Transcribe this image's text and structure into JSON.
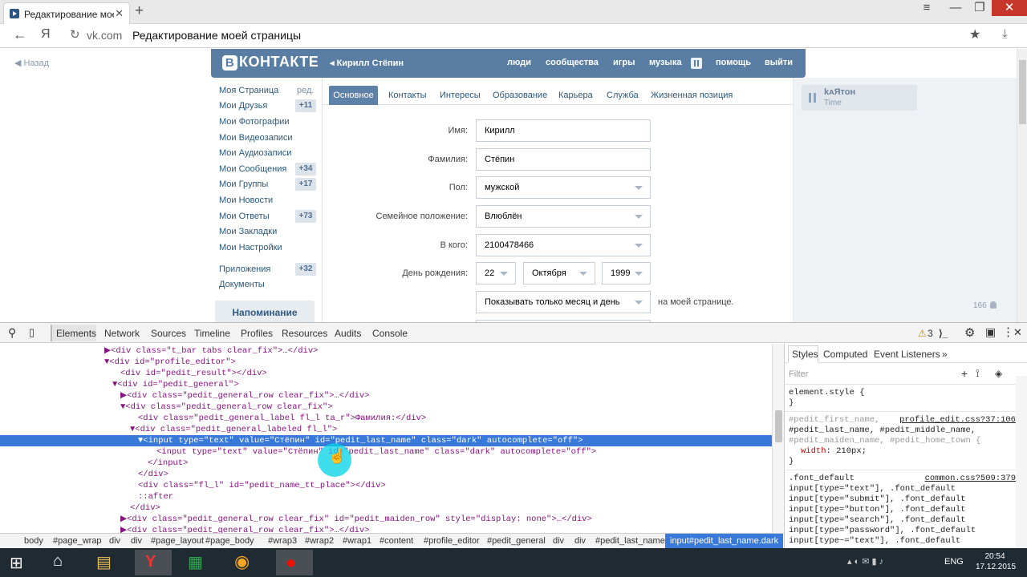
{
  "browser": {
    "tab_title": "Редактирование мое",
    "tab_close": "✕",
    "new_tab": "+",
    "url_host": "vk.com",
    "url_title": "Редактирование моей страницы",
    "yandex_btn": "Я",
    "min": "—",
    "max": "❐",
    "close": "✕",
    "menu": "≡"
  },
  "page": {
    "back_label": "Назад",
    "logo": "КОНТАКТЕ",
    "logo_b": "В",
    "user_name": "Кирилл Стёпин",
    "nav": [
      "люди",
      "сообщества",
      "игры",
      "музыка",
      "помощь",
      "выйти"
    ],
    "sidebar": [
      {
        "label": "Моя Страница"
      },
      {
        "label": "Мои Друзья",
        "count": "+11"
      },
      {
        "label": "Мои Фотографии"
      },
      {
        "label": "Мои Видеозаписи"
      },
      {
        "label": "Мои Аудиозаписи"
      },
      {
        "label": "Мои Сообщения",
        "count": "+34"
      },
      {
        "label": "Мои Группы",
        "count": "+17"
      },
      {
        "label": "Мои Новости"
      },
      {
        "label": "Мои Ответы",
        "count": "+73"
      },
      {
        "label": "Мои Закладки"
      },
      {
        "label": "Мои Настройки"
      },
      {
        "label": "Приложения",
        "count": "+32"
      },
      {
        "label": "Документы"
      }
    ],
    "edit_label": "ред.",
    "reminder": "Напоминание",
    "tabs": [
      "Основное",
      "Контакты",
      "Интересы",
      "Образование",
      "Карьера",
      "Служба",
      "Жизненная позиция"
    ],
    "form": {
      "first_name_label": "Имя:",
      "first_name": "Кирилл",
      "last_name_label": "Фамилия:",
      "last_name": "Стёпин",
      "sex_label": "Пол:",
      "sex": "мужской",
      "status_label": "Семейное положение:",
      "status": "Влюблён",
      "partner_label": "В кого:",
      "partner": "2100478466",
      "bday_label": "День рождения:",
      "bday_day": "22",
      "bday_month": "Октября",
      "bday_year": "1999",
      "bday_show": "Показывать только месяц и день",
      "bday_suffix": "на моей странице."
    },
    "audio_title": "kᴀЯтоʜ",
    "audio_sub": "Time",
    "likes": "166"
  },
  "devtools": {
    "tabs": [
      "Elements",
      "Network",
      "Sources",
      "Timeline",
      "Profiles",
      "Resources",
      "Audits",
      "Console"
    ],
    "warnings": "3",
    "dom": [
      {
        "i": 130,
        "text": "▶<div class=\"t_bar tabs clear_fix\">…</div>"
      },
      {
        "i": 130,
        "text": "▼<div id=\"profile_editor\">"
      },
      {
        "i": 150,
        "text": "<div id=\"pedit_result\"></div>"
      },
      {
        "i": 140,
        "text": "▼<div id=\"pedit_general\">"
      },
      {
        "i": 150,
        "text": "▶<div class=\"pedit_general_row clear_fix\">…</div>"
      },
      {
        "i": 150,
        "text": "▼<div class=\"pedit_general_row clear_fix\">"
      },
      {
        "i": 172,
        "text": "<div class=\"pedit_general_label fl_l ta_r\">Фамилия:</div>"
      },
      {
        "i": 162,
        "text": "▼<div class=\"pedit_general_labeled fl_l\">"
      },
      {
        "i": 172,
        "text": "▼<input type=\"text\" value=\"Стёпин\" id=\"pedit_last_name\" class=\"dark\" autocomplete=\"off\">"
      },
      {
        "i": 195,
        "text": "<input type=\"text\" value=\"Стёпин\" id=\"pedit_last_name\" class=\"dark\" autocomplete=\"off\">"
      },
      {
        "i": 184,
        "text": "</input>"
      },
      {
        "i": 172,
        "text": "</div>"
      },
      {
        "i": 172,
        "text": "<div class=\"fl_l\" id=\"pedit_name_tt_place\"></div>"
      },
      {
        "i": 172,
        "text": "::after"
      },
      {
        "i": 162,
        "text": "</div>"
      },
      {
        "i": 150,
        "text": "▶<div class=\"pedit_general_row clear_fix\" id=\"pedit_maiden_row\" style=\"display: none\">…</div>"
      },
      {
        "i": 150,
        "text": "▶<div class=\"pedit_general_row clear_fix\">…</div>"
      }
    ],
    "crumbs": [
      "body",
      "#page_wrap",
      "div",
      "div",
      "#page_layout",
      "#page_body",
      "#wrap3",
      "#wrap2",
      "#wrap1",
      "#content",
      "#profile_editor",
      "#pedit_general",
      "div",
      "div",
      "#pedit_last_name",
      "input#pedit_last_name.dark"
    ],
    "styles_tabs": [
      "Styles",
      "Computed",
      "Event Listeners",
      "»"
    ],
    "filter": "Filter",
    "element_style": "element.style {",
    "close_brace": "}",
    "rule1_selectors": [
      "#pedit_first_name,",
      "#pedit_last_name, #pedit_middle_name,",
      "#pedit_maiden_name, #pedit_home_town {"
    ],
    "rule1_source": "profile_edit.css?37:106",
    "rule1_prop": "width",
    "rule1_val": "210px;",
    "rule2_source": "common.css?509:379",
    "rule2_selectors": [
      ".font_default",
      "input[type=\"text\"], .font_default",
      "input[type=\"submit\"], .font_default",
      "input[type=\"button\"], .font_default",
      "input[type=\"search\"], .font_default",
      "input[type=\"password\"], .font_default",
      "input[type~=\"text\"], .font_default"
    ]
  },
  "taskbar": {
    "lang": "ENG",
    "time": "20:54",
    "date": "17.12.2015"
  }
}
